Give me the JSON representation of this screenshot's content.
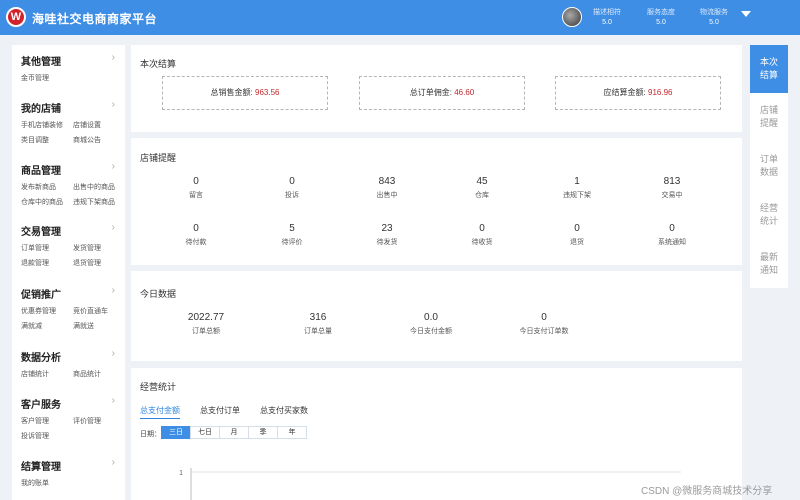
{
  "header": {
    "logo_letter": "W",
    "title": "海哇社交电商商家平台",
    "ratings": [
      {
        "label": "描述相符",
        "value": "5.0"
      },
      {
        "label": "服务态度",
        "value": "5.0"
      },
      {
        "label": "物流服务",
        "value": "5.0"
      }
    ]
  },
  "sidebar": {
    "groups": [
      {
        "title": "其他管理",
        "links": [
          "金币管理"
        ]
      },
      {
        "title": "我的店铺",
        "links": [
          "手机店铺装修",
          "店铺设置",
          "类目调整",
          "商城公告"
        ]
      },
      {
        "title": "商品管理",
        "links": [
          "发布新商品",
          "出售中的商品",
          "仓库中的商品",
          "违规下架商品"
        ]
      },
      {
        "title": "交易管理",
        "links": [
          "订单管理",
          "发货管理",
          "退款管理",
          "退货管理"
        ]
      },
      {
        "title": "促销推广",
        "links": [
          "优惠券管理",
          "竞价直通车",
          "满就减",
          "满就送"
        ]
      },
      {
        "title": "数据分析",
        "links": [
          "店铺统计",
          "商品统计"
        ]
      },
      {
        "title": "客户服务",
        "links": [
          "客户管理",
          "评价管理",
          "投诉管理"
        ]
      },
      {
        "title": "结算管理",
        "links": [
          "我的账单"
        ]
      }
    ]
  },
  "settlement": {
    "title": "本次结算",
    "items": [
      {
        "label": "总销售金额:",
        "value": "963.56"
      },
      {
        "label": "总订单佣金:",
        "value": "46.60"
      },
      {
        "label": "应结算金额:",
        "value": "916.96"
      }
    ]
  },
  "reminders": {
    "title": "店铺提醒",
    "row1": [
      {
        "value": "0",
        "label": "留言"
      },
      {
        "value": "0",
        "label": "投诉"
      },
      {
        "value": "843",
        "label": "出售中"
      },
      {
        "value": "45",
        "label": "仓库"
      },
      {
        "value": "1",
        "label": "违规下架"
      },
      {
        "value": "813",
        "label": "交易中"
      }
    ],
    "row2": [
      {
        "value": "0",
        "label": "待付款"
      },
      {
        "value": "5",
        "label": "待评价"
      },
      {
        "value": "23",
        "label": "待发货"
      },
      {
        "value": "0",
        "label": "待收货"
      },
      {
        "value": "0",
        "label": "退货"
      },
      {
        "value": "0",
        "label": "系统通知"
      }
    ]
  },
  "today": {
    "title": "今日数据",
    "items": [
      {
        "value": "2022.77",
        "label": "订单总额"
      },
      {
        "value": "316",
        "label": "订单总量"
      },
      {
        "value": "0.0",
        "label": "今日支付金额"
      },
      {
        "value": "0",
        "label": "今日支付订单数"
      }
    ]
  },
  "business": {
    "title": "经营统计",
    "tabs": [
      "总支付金额",
      "总支付订单",
      "总支付买家数"
    ],
    "active_tab": 0,
    "date_label": "日期：",
    "ranges": [
      "三日",
      "七日",
      "月",
      "季",
      "年"
    ],
    "active_range": 0,
    "axis_tick": "1"
  },
  "rail": {
    "items": [
      "本次结算",
      "店铺提醒",
      "订单数据",
      "经营统计",
      "最新通知"
    ],
    "active": 0
  },
  "watermark": "CSDN @微服务商城技术分享",
  "colors": {
    "header": "#3e8ee6",
    "accent": "#2f85e0",
    "value_red": "#c0282e",
    "logo_red": "#d3222a"
  }
}
